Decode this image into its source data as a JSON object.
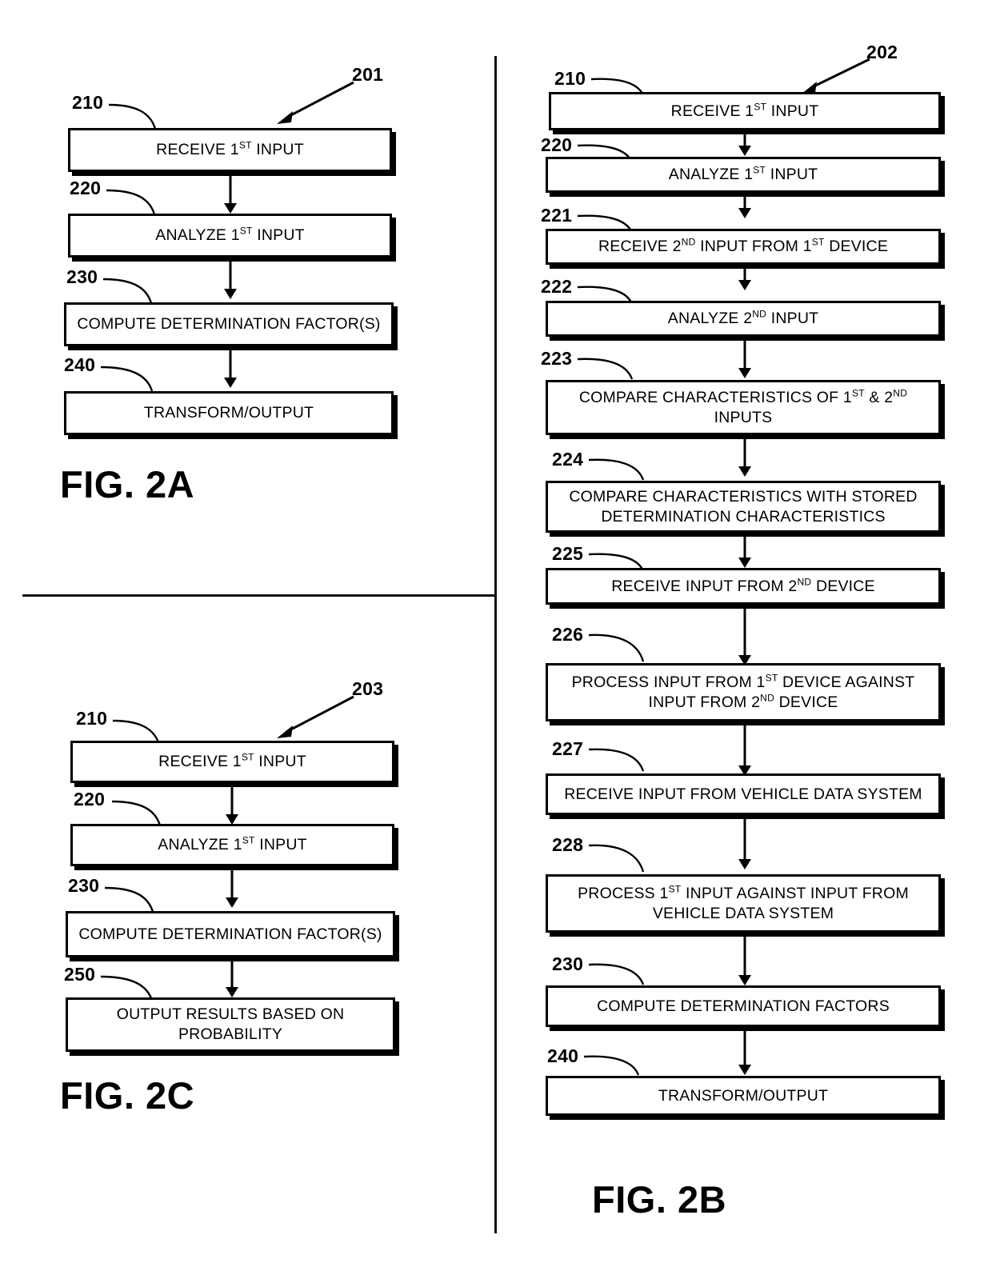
{
  "figures": [
    {
      "id": "fig-2a",
      "title": "FIG. 2A",
      "callout_number": "201",
      "steps": [
        {
          "ref": "210",
          "label": "RECEIVE 1ST INPUT",
          "lines": [
            "RECEIVE 1|ST| INPUT"
          ]
        },
        {
          "ref": "220",
          "label": "ANALYZE 1ST INPUT",
          "lines": [
            "ANALYZE 1|ST| INPUT"
          ]
        },
        {
          "ref": "230",
          "label": "COMPUTE DETERMINATION FACTOR(S)",
          "lines": [
            "COMPUTE DETERMINATION FACTOR(S)"
          ]
        },
        {
          "ref": "240",
          "label": "TRANSFORM/OUTPUT",
          "lines": [
            "TRANSFORM/OUTPUT"
          ]
        }
      ]
    },
    {
      "id": "fig-2c",
      "title": "FIG. 2C",
      "callout_number": "203",
      "steps": [
        {
          "ref": "210",
          "label": "RECEIVE 1ST INPUT",
          "lines": [
            "RECEIVE 1|ST| INPUT"
          ]
        },
        {
          "ref": "220",
          "label": "ANALYZE 1ST INPUT",
          "lines": [
            "ANALYZE 1|ST| INPUT"
          ]
        },
        {
          "ref": "230",
          "label": "COMPUTE DETERMINATION FACTOR(S)",
          "lines": [
            "COMPUTE DETERMINATION FACTOR(S)"
          ]
        },
        {
          "ref": "250",
          "label": "OUTPUT RESULTS BASED ON PROBABILITY",
          "lines": [
            "OUTPUT RESULTS BASED ON",
            "PROBABILITY"
          ]
        }
      ]
    },
    {
      "id": "fig-2b",
      "title": "FIG. 2B",
      "callout_number": "202",
      "steps": [
        {
          "ref": "210",
          "label": "RECEIVE 1ST INPUT",
          "lines": [
            "RECEIVE 1|ST| INPUT"
          ]
        },
        {
          "ref": "220",
          "label": "ANALYZE 1ST INPUT",
          "lines": [
            "ANALYZE 1|ST| INPUT"
          ]
        },
        {
          "ref": "221",
          "label": "RECEIVE 2ND INPUT FROM 1ST DEVICE",
          "lines": [
            "RECEIVE 2|ND| INPUT FROM 1|ST| DEVICE"
          ]
        },
        {
          "ref": "222",
          "label": "ANALYZE 2ND INPUT",
          "lines": [
            "ANALYZE 2|ND| INPUT"
          ]
        },
        {
          "ref": "223",
          "label": "COMPARE CHARACTERISTICS OF 1ST & 2ND INPUTS",
          "lines": [
            "COMPARE CHARACTERISTICS OF 1|ST| & 2|ND|",
            "INPUTS"
          ]
        },
        {
          "ref": "224",
          "label": "COMPARE CHARACTERISTICS WITH STORED DETERMINATION CHARACTERISTICS",
          "lines": [
            "COMPARE CHARACTERISTICS WITH STORED",
            "DETERMINATION CHARACTERISTICS"
          ]
        },
        {
          "ref": "225",
          "label": "RECEIVE INPUT FROM 2ND DEVICE",
          "lines": [
            "RECEIVE INPUT FROM 2|ND| DEVICE"
          ]
        },
        {
          "ref": "226",
          "label": "PROCESS INPUT FROM 1ST DEVICE AGAINST INPUT FROM 2ND DEVICE",
          "lines": [
            "PROCESS INPUT FROM 1|ST| DEVICE AGAINST",
            "INPUT FROM 2|ND| DEVICE"
          ]
        },
        {
          "ref": "227",
          "label": "RECEIVE INPUT FROM VEHICLE DATA SYSTEM",
          "lines": [
            "RECEIVE INPUT FROM VEHICLE DATA SYSTEM"
          ]
        },
        {
          "ref": "228",
          "label": "PROCESS 1ST INPUT AGAINST INPUT FROM VEHICLE DATA SYSTEM",
          "lines": [
            "PROCESS 1|ST| INPUT AGAINST INPUT FROM",
            "VEHICLE DATA SYSTEM"
          ]
        },
        {
          "ref": "230",
          "label": "COMPUTE DETERMINATION FACTORS",
          "lines": [
            "COMPUTE DETERMINATION FACTORS"
          ]
        },
        {
          "ref": "240",
          "label": "TRANSFORM/OUTPUT",
          "lines": [
            "TRANSFORM/OUTPUT"
          ]
        }
      ]
    }
  ],
  "colors": {
    "ink": "#000000",
    "paper": "#ffffff"
  }
}
